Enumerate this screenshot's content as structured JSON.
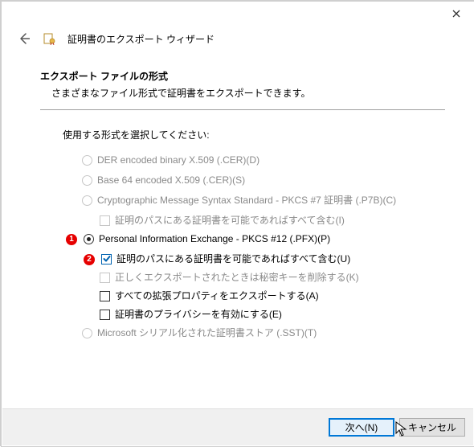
{
  "wizard": {
    "title": "証明書のエクスポート ウィザード"
  },
  "section": {
    "heading": "エクスポート ファイルの形式",
    "sub": "さまざまなファイル形式で証明書をエクスポートできます。"
  },
  "prompt": "使用する形式を選択してください:",
  "options": {
    "der": {
      "label": "DER encoded binary X.509 (.CER)(D)"
    },
    "b64": {
      "label": "Base 64 encoded X.509 (.CER)(S)"
    },
    "p7b": {
      "label": "Cryptographic Message Syntax Standard - PKCS #7 証明書 (.P7B)(C)",
      "include_path": "証明のパスにある証明書を可能であればすべて含む(I)"
    },
    "pfx": {
      "label": "Personal Information Exchange - PKCS #12 (.PFX)(P)",
      "include_path": "証明のパスにある証明書を可能であればすべて含む(U)",
      "del_key": "正しくエクスポートされたときは秘密キーを削除する(K)",
      "ext_props": "すべての拡張プロパティをエクスポートする(A)",
      "privacy": "証明書のプライバシーを有効にする(E)"
    },
    "sst": {
      "label": "Microsoft シリアル化された証明書ストア (.SST)(T)"
    }
  },
  "annotations": {
    "one": "1",
    "two": "2"
  },
  "footer": {
    "next": "次へ(N)",
    "cancel": "キャンセル"
  }
}
